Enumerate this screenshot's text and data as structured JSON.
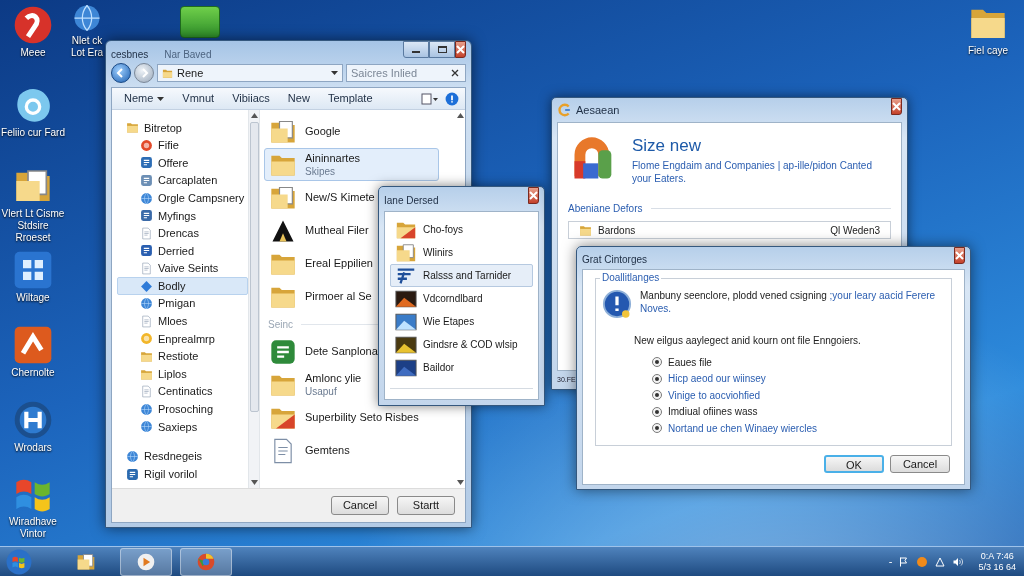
{
  "desktop_icons": [
    {
      "label": "Meee"
    },
    {
      "label": "Feliio cur Fard"
    },
    {
      "label": "Vlert Lt Cisme Stdsire Rroeset"
    },
    {
      "label": "Wiltage"
    },
    {
      "label": "Chernolte"
    },
    {
      "label": "Wrodars"
    },
    {
      "label": "Wiradhave Vintor"
    },
    {
      "label": "Nlet ck Lot Era"
    },
    {
      "label": "Fiel caye"
    }
  ],
  "explorer": {
    "title": "cesbnes",
    "subtitle": "Nar Baved",
    "address": "Rene",
    "search_placeholder": "Saicres Inlied",
    "toolbar": [
      {
        "label": "Neme",
        "menu": true
      },
      {
        "label": "Vmnut",
        "menu": false
      },
      {
        "label": "Vibiiacs",
        "menu": false
      },
      {
        "label": "New",
        "menu": false
      },
      {
        "label": "Template",
        "menu": false
      }
    ],
    "nav": [
      {
        "label": "Bitretop",
        "selected": false,
        "children": [
          {
            "label": "Fifie",
            "selected": false
          },
          {
            "label": "Offere",
            "selected": false
          },
          {
            "label": "Carcaplaten",
            "selected": false
          },
          {
            "label": "Orgle Campsnery",
            "selected": false
          },
          {
            "label": "Myfings",
            "selected": false
          },
          {
            "label": "Drencas",
            "selected": false
          },
          {
            "label": "Derried",
            "selected": false
          },
          {
            "label": "Vaive Seints",
            "selected": false
          },
          {
            "label": "Bodly",
            "selected": true
          },
          {
            "label": "Pmigan",
            "selected": false
          },
          {
            "label": "Mloes",
            "selected": false
          },
          {
            "label": "Enprealmrp",
            "selected": false
          },
          {
            "label": "Restiote",
            "selected": false
          },
          {
            "label": "Liplos",
            "selected": false
          },
          {
            "label": "Centinatics",
            "selected": false
          },
          {
            "label": "Prosoching",
            "selected": false
          },
          {
            "label": "Saxieps",
            "selected": false
          }
        ]
      },
      {
        "label": "Resdnegeis",
        "selected": false
      },
      {
        "label": "Rigil vorilol",
        "selected": false
      }
    ],
    "items": [
      {
        "kind": "item",
        "title": "Google",
        "selected": false
      },
      {
        "kind": "item",
        "title": "Aininnartes",
        "subtitle": "Skipes",
        "selected": true
      },
      {
        "kind": "item",
        "title": "New/S Kimete",
        "selected": false
      },
      {
        "kind": "item",
        "title": "Mutheal Filer",
        "selected": false
      },
      {
        "kind": "item",
        "title": "Ereal Eppilien",
        "selected": false
      },
      {
        "kind": "item",
        "title": "Pirmoer al Se",
        "selected": false
      },
      {
        "kind": "header",
        "title": "Seinc"
      },
      {
        "kind": "item",
        "title": "Dete Sanplona",
        "selected": false
      },
      {
        "kind": "item",
        "title": "Amlonc ylie",
        "subtitle": "Usapuf",
        "selected": false
      },
      {
        "kind": "item",
        "title": "Superbility Seto Risbes",
        "selected": false
      },
      {
        "kind": "item",
        "title": "Gemtens",
        "selected": false
      }
    ],
    "buttons": [
      "Cancel",
      "Startt"
    ]
  },
  "picker": {
    "title": "Iane Dersed",
    "items": [
      {
        "label": "Cho-foys",
        "selected": false
      },
      {
        "label": "Wlinirs",
        "selected": false
      },
      {
        "label": "Ralsss and Tarnider",
        "selected": true
      },
      {
        "label": "Vdcorndlbard",
        "selected": false
      },
      {
        "label": "Wie Etapes",
        "selected": false
      },
      {
        "label": "Gindsre & COD wlsip",
        "selected": false
      },
      {
        "label": "Baildor",
        "selected": false
      }
    ]
  },
  "setup": {
    "title": "Aesaean",
    "heading": "Size new",
    "description": "Flome Engdaim and Companies | ap-ille/pidon Canted your Eaters.",
    "section": "Abeniane Defors",
    "row": {
      "name": "Bardons",
      "value": "Ql Weden3"
    },
    "status": "30.FE"
  },
  "dialog": {
    "title": "Grat Cintorges",
    "group": "Doallitlanges",
    "message": "Manbuny seenclore, plodd vened csigning",
    "message_link": ";your leary aacid Ferere Noves.",
    "prompt": "New eilgus aaylegect anid kourn ont file Enngoiers.",
    "options": [
      {
        "label": "Eaues file",
        "selected": true,
        "kind": "text"
      },
      {
        "label": "Hicp aeod our wiinsey",
        "selected": true,
        "kind": "link"
      },
      {
        "label": "Vinige to aocviohfied",
        "selected": true,
        "kind": "link"
      },
      {
        "label": "Imdiual ofiines wass",
        "selected": true,
        "kind": "text"
      },
      {
        "label": "Nortand ue chen Winaey wiercles",
        "selected": true,
        "kind": "link"
      }
    ],
    "buttons": [
      {
        "label": "OK",
        "default": true
      },
      {
        "label": "Cancel",
        "default": false
      }
    ]
  },
  "taskbar": {
    "items": [
      {
        "running": false
      },
      {
        "running": true
      },
      {
        "running": true
      }
    ],
    "tray_glyph": "-",
    "time": "0:A 7:46",
    "date": "5/3 16 64"
  }
}
